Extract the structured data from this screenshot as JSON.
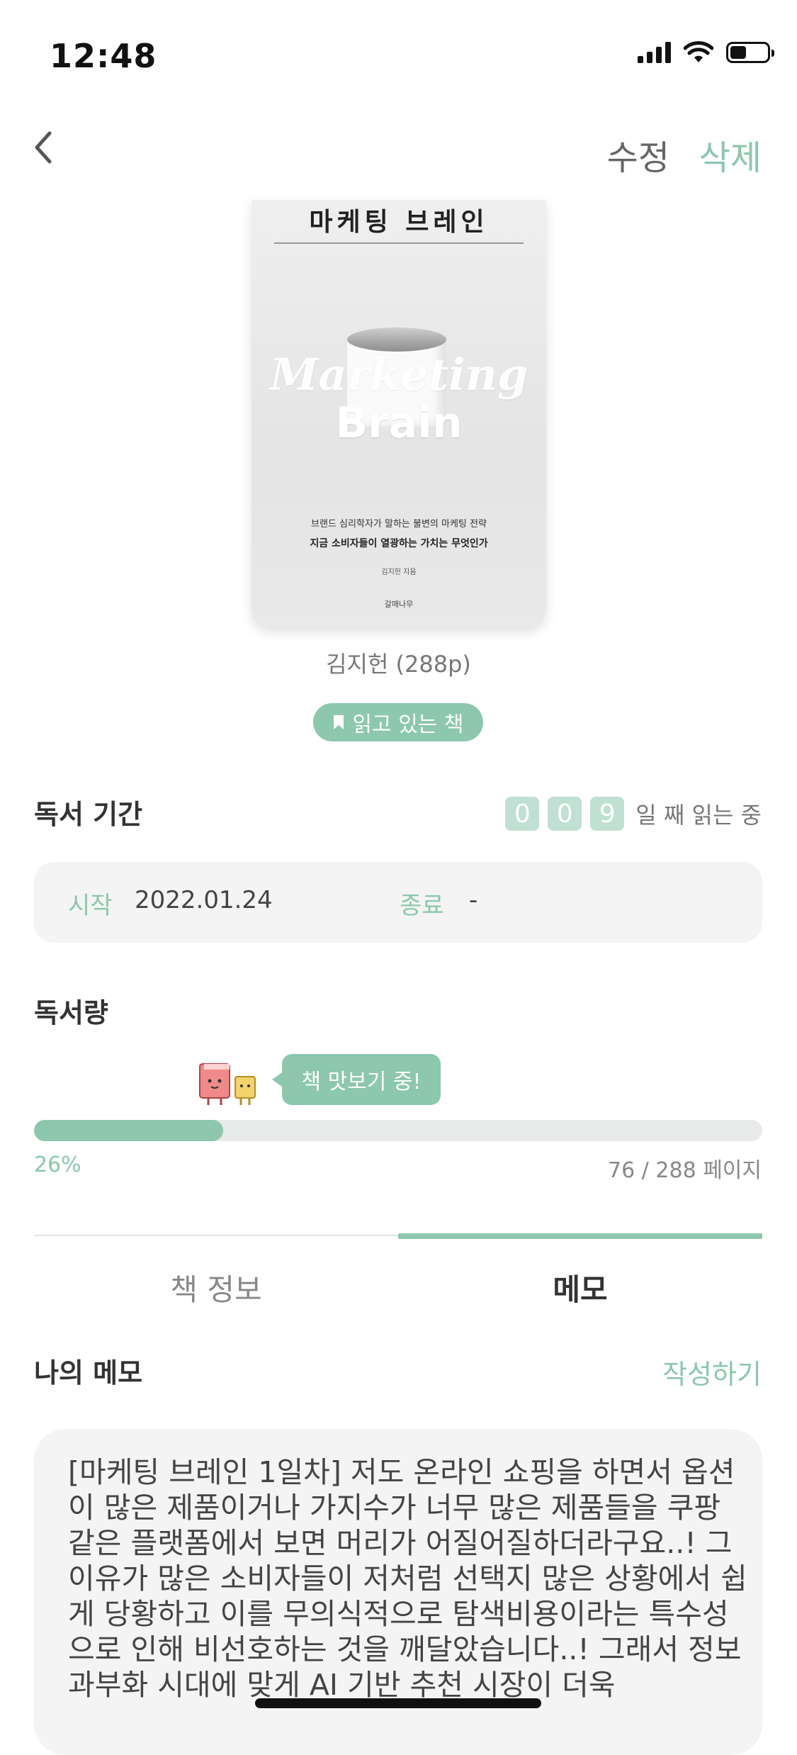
{
  "status_bar": {
    "time": "12:48"
  },
  "nav": {
    "back_icon": "chevron-left-icon",
    "edit_label": "수정",
    "delete_label": "삭제"
  },
  "book": {
    "cover": {
      "title_ko": "마케팅 브레인",
      "title_en_1": "Marketing",
      "title_en_2": "Brain",
      "subtitle_1": "브랜드 심리학자가 말하는 불변의 마케팅 전략",
      "subtitle_2": "지금 소비자들이 열광하는 가치는 무엇인가",
      "author": "김지헌 지음",
      "publisher": "갈매나무"
    },
    "author_pages": "김지헌 (288p)",
    "status_badge": "읽고 있는 책"
  },
  "period": {
    "title": "독서 기간",
    "day_digits": [
      "0",
      "0",
      "9"
    ],
    "day_suffix": "일 째 읽는 중",
    "start_label": "시작",
    "start_value": "2022.01.24",
    "end_label": "종료",
    "end_value": "-"
  },
  "amount": {
    "title": "독서량",
    "bubble": "책 맛보기 중!",
    "progress_fraction": 0.26,
    "percent_text": "26%",
    "pages_text": "76 / 288 페이지"
  },
  "tabs": [
    {
      "label": "책 정보",
      "active": false
    },
    {
      "label": "메모",
      "active": true
    }
  ],
  "memo": {
    "title": "나의 메모",
    "write_label": "작성하기",
    "text": "[마케팅 브레인 1일차] 저도 온라인 쇼핑을 하면서 옵션이 많은 제품이거나 가지수가 너무 많은 제품들을 쿠팡 같은 플랫폼에서 보면 머리가 어질어질하더라구요..! 그 이유가 많은 소비자들이 저처럼 선택지 많은 상황에서 쉽게 당황하고 이를 무의식적으로 탐색비용이라는 특수성으로 인해 비선호하는 것을 깨달았습니다..! 그래서 정보과부화 시대에 맞게 AI 기반 추천 시장이 더욱"
  },
  "colors": {
    "accent": "#8cc7ae",
    "digit_bg": "#bfe0d2",
    "box_bg": "#f3f4f3"
  }
}
